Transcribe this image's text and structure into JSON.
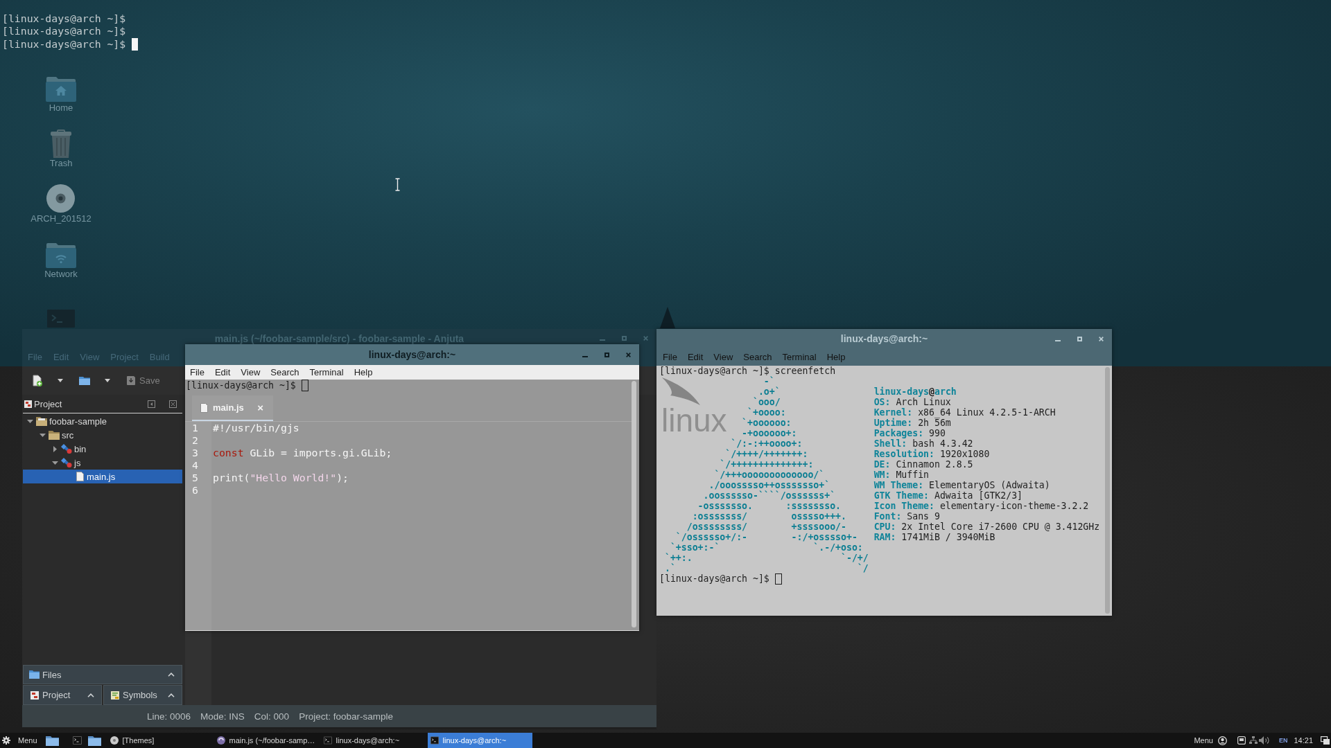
{
  "desktop": {
    "terminal_lines": [
      "[linux-days@arch ~]$",
      "[linux-days@arch ~]$",
      "[linux-days@arch ~]$"
    ],
    "icons": [
      {
        "kind": "home",
        "label": "Home"
      },
      {
        "kind": "trash",
        "label": "Trash"
      },
      {
        "kind": "disc",
        "label": "ARCH_201512"
      },
      {
        "kind": "network",
        "label": "Network"
      },
      {
        "kind": "terminal"
      }
    ]
  },
  "anjuta": {
    "title": "main.js (~/foobar-sample/src) - foobar-sample - Anjuta",
    "menu": [
      "File",
      "Edit",
      "View",
      "Project",
      "Build"
    ],
    "toolbar": {
      "save": {
        "label": "Save",
        "disabled": true
      }
    },
    "project": {
      "title": "Project",
      "tree": [
        {
          "label": "foobar-sample",
          "kind": "project",
          "expanded": true,
          "selected": false,
          "children": [
            {
              "label": "src",
              "kind": "folder",
              "expanded": true,
              "selected": false,
              "children": [
                {
                  "label": "bin",
                  "kind": "package",
                  "expanded": false,
                  "selected": false
                },
                {
                  "label": "js",
                  "kind": "package",
                  "expanded": true,
                  "selected": false,
                  "children": [
                    {
                      "label": "main.js",
                      "kind": "file",
                      "selected": true
                    }
                  ]
                }
              ]
            }
          ]
        }
      ]
    },
    "editor": {
      "tab": {
        "label": "main.js",
        "close": "×"
      },
      "lines": [
        {
          "number": "1",
          "tokens": [
            {
              "kind": "plain",
              "text": "#!/usr/bin/gjs"
            }
          ]
        },
        {
          "number": "2"
        },
        {
          "number": "3",
          "tokens": [
            {
              "kind": "keyword",
              "text": "const"
            },
            {
              "kind": "plain",
              "text": " GLib = imports.gi.GLib;"
            }
          ]
        },
        {
          "number": "4"
        },
        {
          "number": "5",
          "tokens": [
            {
              "kind": "plain",
              "text": "print("
            },
            {
              "kind": "string",
              "text": "\"Hello World!\""
            },
            {
              "kind": "plain",
              "text": ");"
            }
          ]
        },
        {
          "number": "6"
        }
      ]
    },
    "files_bar": {
      "label": "Files"
    },
    "panel_tabs": [
      {
        "kind": "project",
        "label": "Project"
      },
      {
        "kind": "symbols",
        "label": "Symbols"
      }
    ],
    "status_bar": [
      "Line: 0006",
      "Mode: INS",
      "Col: 000",
      "Project: foobar-sample"
    ]
  },
  "terminal_small": {
    "title": "linux-days@arch:~",
    "menu": [
      "File",
      "Edit",
      "View",
      "Search",
      "Terminal",
      "Help"
    ],
    "prompt": "[linux-days@arch ~]$"
  },
  "terminal_screenfetch": {
    "title": "linux-days@arch:~",
    "menu": [
      "File",
      "Edit",
      "View",
      "Search",
      "Terminal",
      "Help"
    ],
    "background_logo": "linux",
    "command_line": "[linux-days@arch ~]$ screenfetch",
    "ascii_art": [
      "                   -`",
      "                  .o+`",
      "                 `ooo/",
      "                `+oooo:",
      "               `+oooooo:",
      "               -+oooooo+:",
      "             `/:-:++oooo+:",
      "            `/++++/+++++++:",
      "           `/++++++++++++++:",
      "          `/+++ooooooooooooo/`",
      "         ./ooosssso++osssssso+`",
      "        .oossssso-````/ossssss+`",
      "       -osssssso.      :ssssssso.",
      "      :osssssss/        osssso+++.",
      "     /ossssssss/        +ssssooo/-",
      "   `/ossssso+/:-        -:/+osssso+-",
      "  `+sso+:-`                 `.-/+oso:",
      " `++:.                           `-/+/",
      " .`                                 `/"
    ],
    "user_host": {
      "user": "linux-days",
      "at": "@",
      "host": "arch"
    },
    "info": [
      {
        "label": "OS:",
        "value": "Arch Linux"
      },
      {
        "label": "Kernel:",
        "value": "x86_64 Linux 4.2.5-1-ARCH"
      },
      {
        "label": "Uptime:",
        "value": "2h 56m"
      },
      {
        "label": "Packages:",
        "value": "990"
      },
      {
        "label": "Shell:",
        "value": "bash 4.3.42"
      },
      {
        "label": "Resolution:",
        "value": "1920x1080"
      },
      {
        "label": "DE:",
        "value": "Cinnamon 2.8.5"
      },
      {
        "label": "WM:",
        "value": "Muffin"
      },
      {
        "label": "WM Theme:",
        "value": "ElementaryOS (Adwaita)"
      },
      {
        "label": "GTK Theme:",
        "value": "Adwaita [GTK2/3]"
      },
      {
        "label": "Icon Theme:",
        "value": "elementary-icon-theme-3.2.2"
      },
      {
        "label": "Font:",
        "value": "Sans 9"
      },
      {
        "label": "CPU:",
        "value": "2x Intel Core i7-2600 CPU @ 3.412GHz"
      },
      {
        "label": "RAM:",
        "value": "1741MiB / 3940MiB"
      }
    ],
    "prompt": "[linux-days@arch ~]$"
  },
  "taskbar": {
    "menu_label": "Menu",
    "windows": [
      {
        "kind": "themes",
        "label": "[Themes]",
        "selected": false
      },
      {
        "kind": "anjuta",
        "label": "main.js (~/foobar-samp…",
        "selected": false
      },
      {
        "kind": "terminal",
        "label": "linux-days@arch:~",
        "selected": false
      },
      {
        "kind": "terminal",
        "label": "linux-days@arch:~",
        "selected": true
      }
    ],
    "tray_menu_label": "Menu",
    "keyboard_layout": "EN",
    "clock": "14:21"
  }
}
